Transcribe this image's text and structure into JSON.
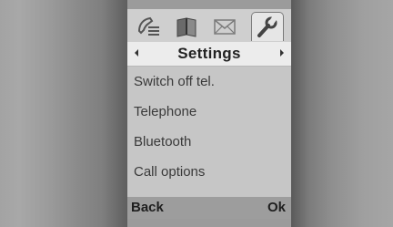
{
  "tabs": [
    {
      "icon": "phone-icon",
      "active": false
    },
    {
      "icon": "book-icon",
      "active": false
    },
    {
      "icon": "envelope-icon",
      "active": false
    },
    {
      "icon": "wrench-icon",
      "active": true
    }
  ],
  "header": {
    "title": "Settings"
  },
  "menu": {
    "items": [
      {
        "label": "Switch off tel."
      },
      {
        "label": "Telephone"
      },
      {
        "label": "Bluetooth"
      },
      {
        "label": "Call options"
      }
    ]
  },
  "softkeys": {
    "left": "Back",
    "right": "Ok"
  },
  "colors": {
    "screen_bg": "#c6c6c6",
    "titlebar_bg": "#ececec",
    "softkey_bar_bg": "#9d9d9d",
    "bezel": "#8a8a8a"
  }
}
